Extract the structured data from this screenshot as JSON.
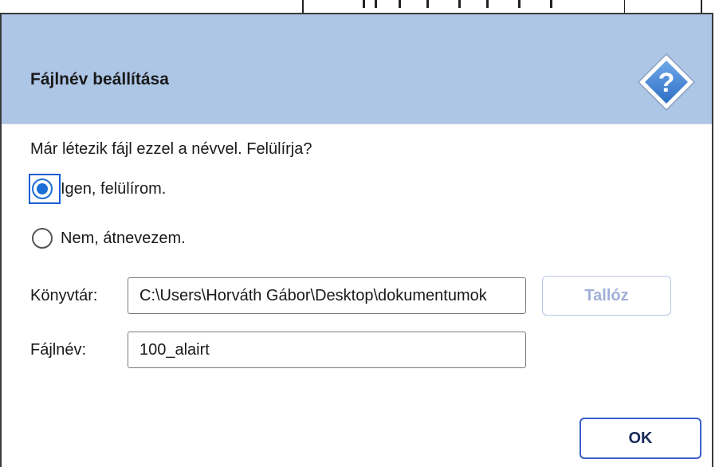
{
  "dialog": {
    "title": "Fájlnév beállítása",
    "icon": "help-question-icon",
    "question": "Már létezik fájl ezzel a névvel. Felülírja?",
    "options": [
      {
        "label": "Igen, felülírom.",
        "checked": true
      },
      {
        "label": "Nem, átnevezem.",
        "checked": false
      }
    ],
    "directory": {
      "label": "Könyvtár:",
      "value": "C:\\Users\\Horváth Gábor\\Desktop\\dokumentumok"
    },
    "filename": {
      "label": "Fájlnév:",
      "value": "100_alairt"
    },
    "browse_label": "Tallóz",
    "ok_label": "OK"
  },
  "colors": {
    "header_bg": "#aec6e6",
    "accent": "#1a6fd6",
    "disabled_text": "#9fb0d6"
  }
}
